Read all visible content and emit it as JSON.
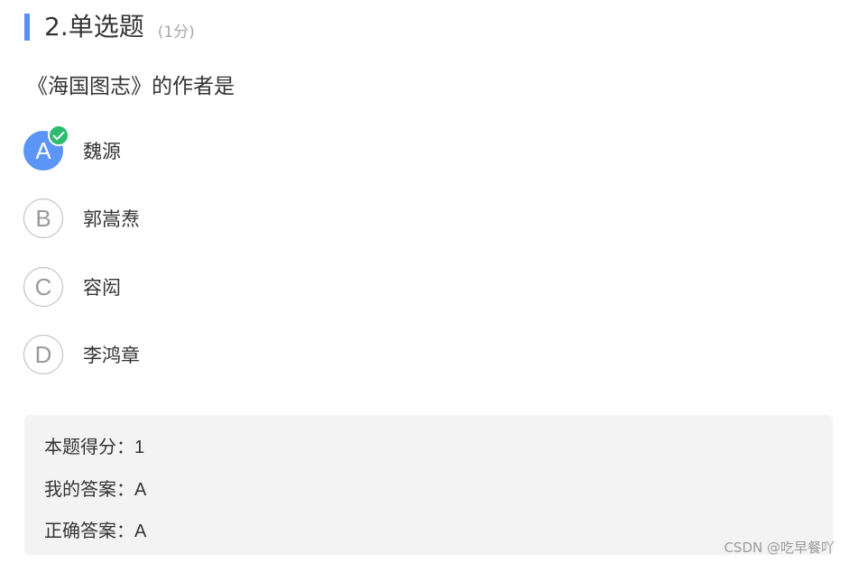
{
  "question": {
    "title": "2.单选题",
    "score": "(1分)",
    "text": "《海国图志》的作者是"
  },
  "options": [
    {
      "letter": "A",
      "text": "魏源",
      "selected": true,
      "correct": true
    },
    {
      "letter": "B",
      "text": "郭嵩焘",
      "selected": false,
      "correct": false
    },
    {
      "letter": "C",
      "text": "容闳",
      "selected": false,
      "correct": false
    },
    {
      "letter": "D",
      "text": "李鸿章",
      "selected": false,
      "correct": false
    }
  ],
  "result": {
    "score_label": "本题得分：",
    "score_value": "1",
    "my_answer_label": "我的答案：",
    "my_answer_value": "A",
    "correct_answer_label": "正确答案：",
    "correct_answer_value": "A"
  },
  "watermark": "CSDN @吃早餐吖",
  "colors": {
    "accent": "#5b8ff9",
    "selected_option": "#5b95f5",
    "check_badge": "#2cbb6f",
    "result_background": "#f3f3f3"
  },
  "icons": {
    "check": "check-icon"
  }
}
